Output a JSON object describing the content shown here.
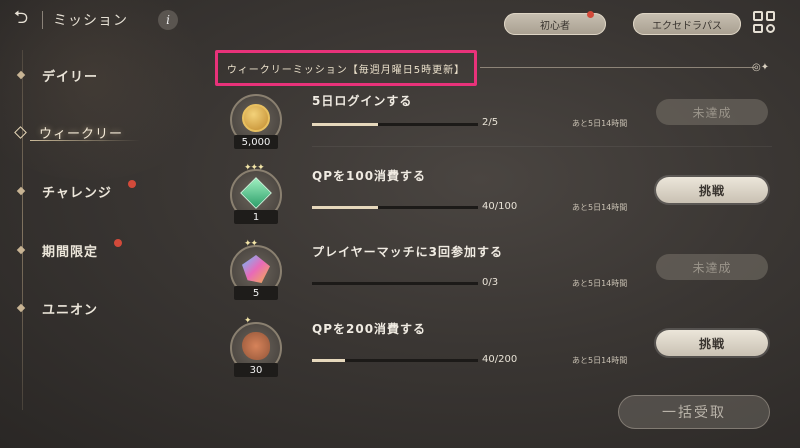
{
  "header": {
    "back_icon": "back-arrow-icon",
    "title": "ミッション",
    "info_label": "i"
  },
  "top_right": {
    "pills": [
      {
        "label": "初心者",
        "has_badge": true
      },
      {
        "label": "エクセドラパス",
        "has_badge": false
      }
    ],
    "menu_icon": "grid-menu-icon"
  },
  "sidebar": {
    "items": [
      {
        "label": "デイリー",
        "active": false,
        "badge": false
      },
      {
        "label": "ウィークリー",
        "active": true,
        "badge": false
      },
      {
        "label": "チャレンジ",
        "active": false,
        "badge": true
      },
      {
        "label": "期間限定",
        "active": false,
        "badge": true
      },
      {
        "label": "ユニオン",
        "active": false,
        "badge": false
      }
    ]
  },
  "section": {
    "title": "ウィークリーミッション【毎週月曜日5時更新】"
  },
  "missions": [
    {
      "title": "5日ログインする",
      "reward_qty": "5,000",
      "reward_icon": "coin-icon",
      "progress_text": "2/5",
      "progress": 0.4,
      "time_left": "あと5日14時間",
      "button": "未達成",
      "button_enabled": false
    },
    {
      "title": "QPを100消費する",
      "reward_qty": "1",
      "reward_icon": "green-gem-icon",
      "progress_text": "40/100",
      "progress": 0.4,
      "time_left": "あと5日14時間",
      "button": "挑戦",
      "button_enabled": true
    },
    {
      "title": "プレイヤーマッチに3回参加する",
      "reward_qty": "5",
      "reward_icon": "rainbow-crystal-icon",
      "progress_text": "0/3",
      "progress": 0.0,
      "time_left": "あと5日14時間",
      "button": "未達成",
      "button_enabled": false
    },
    {
      "title": "QPを200消費する",
      "reward_qty": "30",
      "reward_icon": "palette-icon",
      "progress_text": "40/200",
      "progress": 0.2,
      "time_left": "あと5日14時間",
      "button": "挑戦",
      "button_enabled": true
    }
  ],
  "footer": {
    "bulk_receive_label": "一括受取"
  }
}
